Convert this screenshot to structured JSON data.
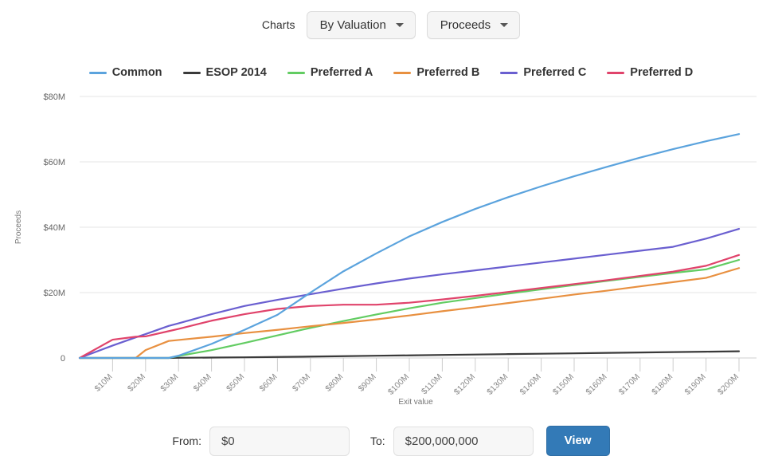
{
  "toolbar": {
    "label": "Charts",
    "valuation_dropdown": "By Valuation",
    "proceeds_dropdown": "Proceeds"
  },
  "bottom": {
    "from_label": "From:",
    "from_value": "$0",
    "from_placeholder": "$0",
    "to_label": "To:",
    "to_value": "$200,000,000",
    "to_placeholder": "$200,000,000",
    "view_label": "View"
  },
  "colors": {
    "common": "#5ba3dd",
    "esop": "#3a3a3a",
    "preferred_a": "#62cc62",
    "preferred_b": "#e89040",
    "preferred_c": "#6a5fd0",
    "preferred_d": "#e0436b",
    "accent_button": "#337ab7",
    "grid": "#e4e4e4"
  },
  "chart_data": {
    "type": "line",
    "title": "",
    "xlabel": "Exit value",
    "ylabel": "Proceeds",
    "grid": true,
    "legend_position": "top",
    "xlim": [
      0,
      200
    ],
    "ylim": [
      0,
      80
    ],
    "x_unit": "$M",
    "y_unit": "$M",
    "xtick_labels": [
      "$10M",
      "$20M",
      "$30M",
      "$40M",
      "$50M",
      "$60M",
      "$70M",
      "$80M",
      "$90M",
      "$100M",
      "$110M",
      "$120M",
      "$130M",
      "$140M",
      "$150M",
      "$160M",
      "$170M",
      "$180M",
      "$190M",
      "$200M"
    ],
    "xticks": [
      10,
      20,
      30,
      40,
      50,
      60,
      70,
      80,
      90,
      100,
      110,
      120,
      130,
      140,
      150,
      160,
      170,
      180,
      190,
      200
    ],
    "ytick_labels": [
      "0",
      "$20M",
      "$40M",
      "$60M",
      "$80M"
    ],
    "yticks": [
      0,
      20,
      40,
      60,
      80
    ],
    "x": [
      0,
      10,
      17,
      20,
      27,
      30,
      40,
      50,
      60,
      70,
      80,
      90,
      100,
      110,
      120,
      130,
      140,
      150,
      160,
      170,
      180,
      190,
      200
    ],
    "series": [
      {
        "name": "Common",
        "color": "#5ba3dd",
        "values": [
          0,
          0,
          0,
          0,
          0,
          0.7,
          4.3,
          8.6,
          13.2,
          20.0,
          26.5,
          32.0,
          37.2,
          41.6,
          45.6,
          49.2,
          52.5,
          55.6,
          58.5,
          61.3,
          63.9,
          66.3,
          68.5
        ]
      },
      {
        "name": "ESOP 2014",
        "color": "#3a3a3a",
        "values": [
          0,
          0,
          0,
          0,
          0,
          0.05,
          0.12,
          0.2,
          0.3,
          0.42,
          0.55,
          0.68,
          0.8,
          0.93,
          1.05,
          1.18,
          1.3,
          1.42,
          1.55,
          1.68,
          1.8,
          1.92,
          2.05
        ]
      },
      {
        "name": "Preferred A",
        "color": "#62cc62",
        "values": [
          0,
          0,
          0,
          0,
          0,
          0.6,
          2.4,
          4.6,
          6.9,
          9.2,
          11.3,
          13.3,
          15.2,
          16.9,
          18.3,
          19.7,
          21.0,
          22.3,
          23.6,
          24.8,
          26.0,
          27.1,
          30.0
        ]
      },
      {
        "name": "Preferred B",
        "color": "#e89040",
        "values": [
          0,
          0,
          0,
          2.4,
          5.2,
          5.5,
          6.5,
          7.6,
          8.6,
          9.7,
          10.7,
          11.8,
          13.0,
          14.3,
          15.5,
          16.8,
          18.1,
          19.4,
          20.6,
          21.9,
          23.2,
          24.5,
          27.5
        ]
      },
      {
        "name": "Preferred C",
        "color": "#6a5fd0",
        "values": [
          0,
          3.8,
          6.3,
          7.3,
          9.8,
          10.6,
          13.4,
          15.9,
          17.8,
          19.5,
          21.2,
          22.8,
          24.3,
          25.6,
          26.8,
          28.0,
          29.2,
          30.4,
          31.6,
          32.8,
          34.0,
          36.5,
          39.5
        ]
      },
      {
        "name": "Preferred D",
        "color": "#e0436b",
        "values": [
          0,
          5.6,
          6.5,
          6.6,
          8.2,
          8.9,
          11.4,
          13.4,
          15.0,
          15.9,
          16.3,
          16.3,
          16.9,
          17.9,
          19.0,
          20.2,
          21.4,
          22.6,
          23.8,
          25.1,
          26.4,
          28.2,
          31.5
        ]
      }
    ]
  }
}
